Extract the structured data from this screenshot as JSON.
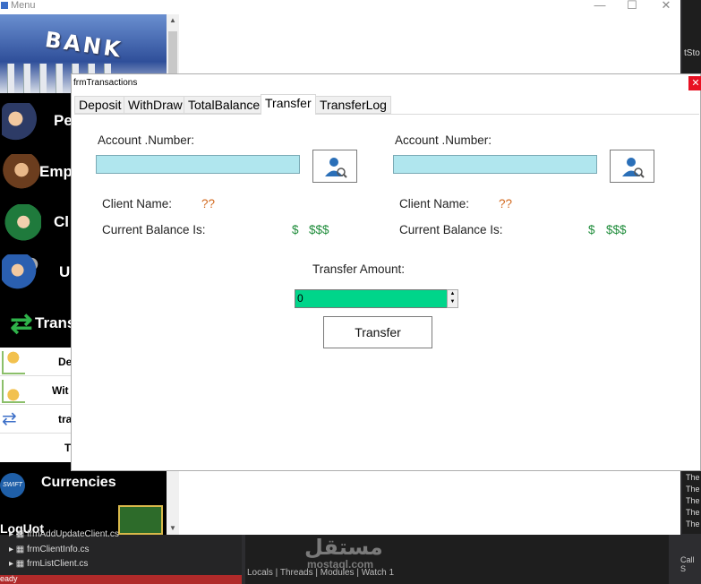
{
  "menu_window": {
    "title": "Menu",
    "minimize": "—",
    "maximize": "☐",
    "close": "✕",
    "banner_text": "BANK",
    "sidebar_items": [
      {
        "label": "Pe"
      },
      {
        "label": "Emp"
      },
      {
        "label": "Cl"
      },
      {
        "label": "U"
      },
      {
        "label": "Trans"
      }
    ],
    "sub_items": [
      {
        "label": "De"
      },
      {
        "label": "Wit"
      },
      {
        "label": "tra"
      },
      {
        "label": "T"
      }
    ],
    "currencies_label": "Currencies",
    "swift_label": "SWIFT",
    "logout_label": "LogUot"
  },
  "dialog": {
    "title": "frmTransactions",
    "close": "✕",
    "tabs": [
      "Deposit",
      "WithDraw",
      "TotalBalance",
      "Transfer",
      "TransferLog"
    ],
    "active_tab": "Transfer",
    "left": {
      "account_label": "Account .Number:",
      "account_value": "",
      "client_name_label": "Client Name:",
      "client_name_value": "??",
      "balance_label": "Current Balance Is:",
      "currency_symbol": "$",
      "balance_value": "$$$"
    },
    "right": {
      "account_label": "Account .Number:",
      "account_value": "",
      "client_name_label": "Client Name:",
      "client_name_value": "??",
      "balance_label": "Current Balance Is:",
      "currency_symbol": "$",
      "balance_value": "$$$"
    },
    "transfer_amount_label": "Transfer Amount:",
    "transfer_amount_value": "0",
    "transfer_button": "Transfer"
  },
  "ide": {
    "files": [
      "frmAddUpdateClient.cs",
      "frmClientInfo.cs",
      "frmListClient.cs"
    ],
    "tabs": [
      "Locals",
      "Threads",
      "Modules",
      "Watch 1"
    ],
    "status": "eady",
    "right_text": "tSto",
    "output_lines": [
      "The",
      "The",
      "The",
      "The",
      "The"
    ],
    "call_stack": "Call S"
  },
  "watermark": {
    "arabic": "مستقل",
    "latin": "mostaql.com"
  },
  "colors": {
    "account_input": "#b0e6ee",
    "amount_input": "#00d58a",
    "question": "#d2691e",
    "money": "#1e8c3a"
  }
}
